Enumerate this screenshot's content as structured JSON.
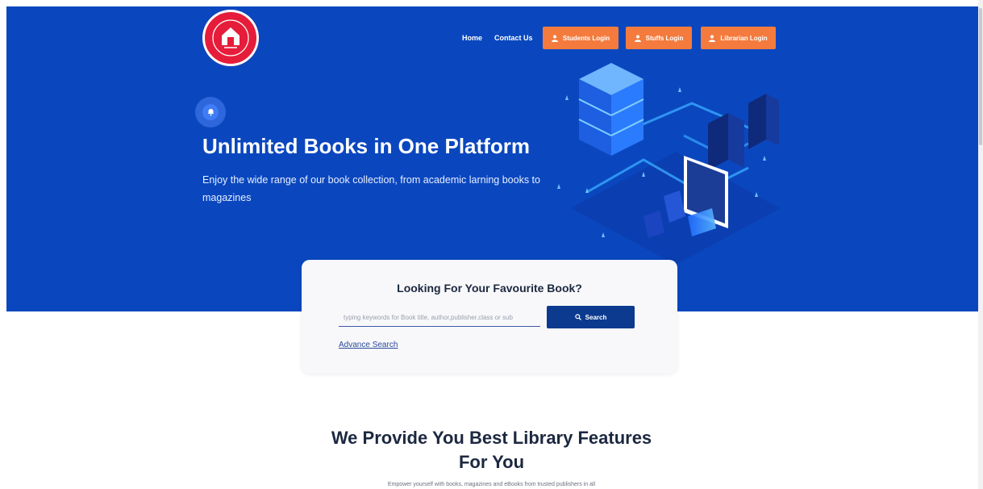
{
  "header": {
    "logo_alt": "College logo",
    "nav": {
      "home": "Home",
      "contact": "Contact Us"
    },
    "buttons": {
      "students_login": "Students Login",
      "stuffs_login": "Stuffs Login",
      "librarian_login": "Librarian Login"
    },
    "accent_color": "#f47b3d"
  },
  "hero": {
    "title": "Unlimited Books in One Platform",
    "subtitle": "Enjoy the wide range of our book collection, from academic larning books to magazines",
    "background_color": "#0a47bf",
    "icons": [
      "bell-icon"
    ]
  },
  "search": {
    "title": "Looking For Your Favourite Book?",
    "placeholder": "typing keywords for Book title, author,publisher,class or sub",
    "value": "",
    "button_label": "Search",
    "advance_link": "Advance Search"
  },
  "features": {
    "title_line1": "We Provide You Best Library Features",
    "title_line2": "For You",
    "subtitle_partial": "Empower yourself with books, magazines and eBooks from trusted publishers in all"
  }
}
